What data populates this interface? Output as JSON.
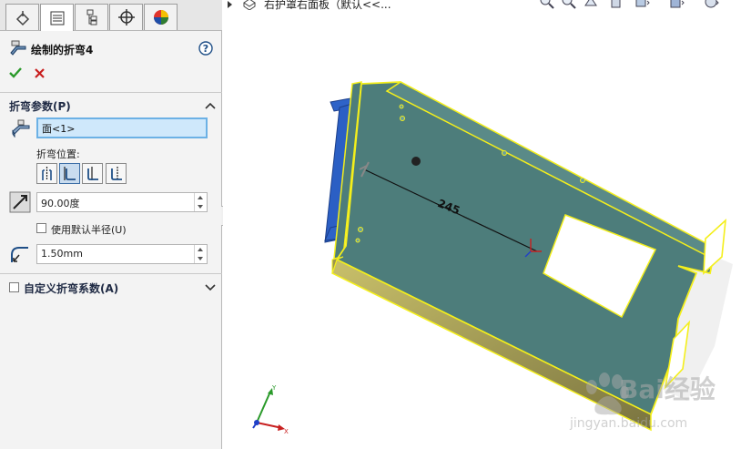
{
  "feature": {
    "title": "绘制的折弯4",
    "help_glyph": "?"
  },
  "sections": {
    "bend_params_title": "折弯参数(P)",
    "face_value": "面<1>",
    "bend_position_label": "折弯位置:",
    "angle_value": "90.00度",
    "use_default_radius_label": "使用默认半径(U)",
    "radius_value": "1.50mm",
    "custom_allowance_label": "自定义折弯系数(A)"
  },
  "viewport": {
    "breadcrumb": "右护罩右面板（默认<<...",
    "dimension": "245"
  },
  "triad_labels": {
    "x": "X",
    "y": "Y"
  },
  "watermark": {
    "text": "Bai经验",
    "subtext": "jingyan.baidu.com"
  },
  "colors": {
    "panel_bg": "#f3f3f3",
    "selection_blue": "#cfe8fb",
    "part_teal": "#4d7d7b",
    "edge_yellow": "#f4ef1b",
    "tab_blue": "#2e63c8",
    "ok_green": "#2a9a2a",
    "cancel_red": "#c81e1e"
  }
}
